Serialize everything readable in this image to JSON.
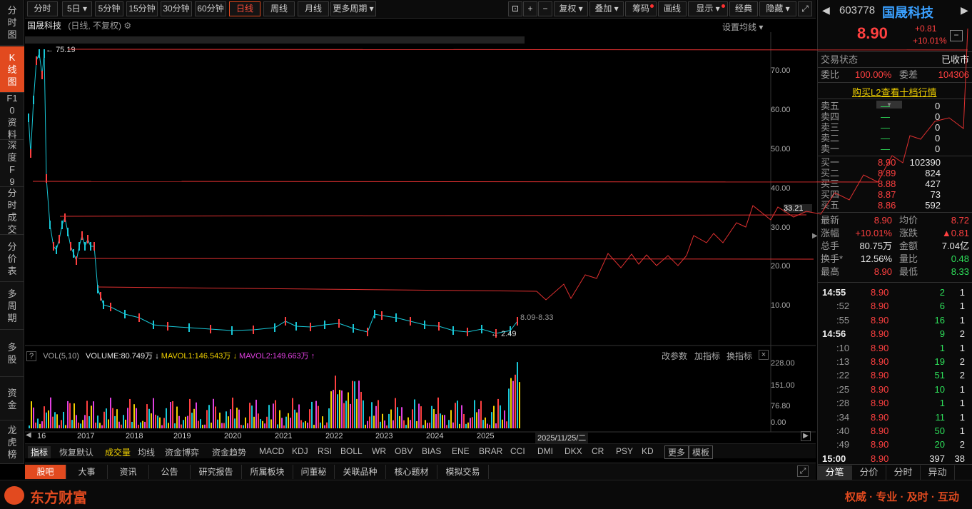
{
  "sidebar": {
    "items": [
      "分时图",
      "K线图",
      "F10资料",
      "深度F9",
      "分时成交",
      "分价表",
      "多周期",
      "多股",
      "资金",
      "龙虎榜"
    ]
  },
  "toolbar": {
    "periods": [
      "分时",
      "5日",
      "5分钟",
      "15分钟",
      "30分钟",
      "60分钟",
      "日线",
      "周线",
      "月线",
      "更多周期"
    ],
    "active_period": "日线",
    "right": [
      "复权",
      "叠加",
      "筹码",
      "画线",
      "显示",
      "经典",
      "隐藏"
    ]
  },
  "chart": {
    "stock_name": "国晟科技",
    "mode": "(日线, 不复权)",
    "settings": "设置均线",
    "price_levels": [
      "70.00",
      "60.00",
      "50.00",
      "40.00",
      "30.00",
      "20.00",
      "10.00"
    ],
    "current_marker": "33.21",
    "high_marker": "75.19",
    "low_marker": "2.49",
    "range_marker": "8.09-8.33",
    "vol_line": {
      "label": "VOL(5,10)",
      "volume": "VOLUME:80.749万",
      "mavol1": "MAVOL1:146.543万",
      "mavol2": "MAVOL2:149.663万"
    },
    "vol_buttons": [
      "改参数",
      "加指标",
      "换指标"
    ],
    "vol_levels": [
      "228.00",
      "151.00",
      "76.80",
      "0.00"
    ],
    "years": [
      "16",
      "2017",
      "2018",
      "2019",
      "2020",
      "2021",
      "2022",
      "2023",
      "2024",
      "2025"
    ],
    "cursor_date": "2025/11/25/二"
  },
  "indicators": [
    "指标",
    "恢复默认",
    "成交量",
    "均线",
    "资金博弈",
    "资金趋势",
    "MACD",
    "KDJ",
    "RSI",
    "BOLL",
    "WR",
    "OBV",
    "BIAS",
    "ENE",
    "BRAR",
    "CCI",
    "DMI",
    "DKX",
    "CR",
    "PSY",
    "KD",
    "更多",
    "模板"
  ],
  "bottom_tabs": [
    "股吧",
    "大事",
    "资讯",
    "公告",
    "研究报告",
    "所属板块",
    "问董秘",
    "关联品种",
    "核心题材",
    "模拟交易"
  ],
  "footer": {
    "brand": "东方财富",
    "slogan": "权威 · 专业 · 及时 · 互动"
  },
  "quote": {
    "code": "603778",
    "name": "国晟科技",
    "price": "8.90",
    "change": "+0.81",
    "pct": "+10.01%",
    "status_label": "交易状态",
    "status": "已收市",
    "weibi_label": "委比",
    "weibi": "100.00%",
    "weicha_label": "委差",
    "weicha": "104306",
    "l2": "购买L2查看十档行情",
    "asks": [
      {
        "label": "卖五",
        "price": "—",
        "vol": "0"
      },
      {
        "label": "卖四",
        "price": "—",
        "vol": "0"
      },
      {
        "label": "卖三",
        "price": "—",
        "vol": "0"
      },
      {
        "label": "卖二",
        "price": "—",
        "vol": "0"
      },
      {
        "label": "卖一",
        "price": "—",
        "vol": "0"
      }
    ],
    "bids": [
      {
        "label": "买一",
        "price": "8.90",
        "vol": "102390"
      },
      {
        "label": "买二",
        "price": "8.89",
        "vol": "824"
      },
      {
        "label": "买三",
        "price": "8.88",
        "vol": "427"
      },
      {
        "label": "买四",
        "price": "8.87",
        "vol": "73"
      },
      {
        "label": "买五",
        "price": "8.86",
        "vol": "592"
      }
    ],
    "stats": [
      {
        "l1": "最新",
        "v1": "8.90",
        "l2": "均价",
        "v2": "8.72"
      },
      {
        "l1": "涨幅",
        "v1": "+10.01%",
        "l2": "涨跌",
        "v2": "▲0.81"
      },
      {
        "l1": "总手",
        "v1": "80.75万",
        "l2": "金额",
        "v2": "7.04亿"
      },
      {
        "l1": "换手*",
        "v1": "12.56%",
        "l2": "量比",
        "v2": "0.48"
      },
      {
        "l1": "最高",
        "v1": "8.90",
        "l2": "最低",
        "v2": "8.33"
      }
    ],
    "ticks": [
      {
        "t": "14:55",
        "p": "8.90",
        "v": "2",
        "n": "1"
      },
      {
        "t": ":52",
        "p": "8.90",
        "v": "6",
        "n": "1"
      },
      {
        "t": ":55",
        "p": "8.90",
        "v": "16",
        "n": "1"
      },
      {
        "t": "14:56",
        "p": "8.90",
        "v": "9",
        "n": "2"
      },
      {
        "t": ":10",
        "p": "8.90",
        "v": "1",
        "n": "1"
      },
      {
        "t": ":13",
        "p": "8.90",
        "v": "19",
        "n": "2"
      },
      {
        "t": ":22",
        "p": "8.90",
        "v": "51",
        "n": "2"
      },
      {
        "t": ":25",
        "p": "8.90",
        "v": "10",
        "n": "1"
      },
      {
        "t": ":28",
        "p": "8.90",
        "v": "1",
        "n": "1"
      },
      {
        "t": ":34",
        "p": "8.90",
        "v": "11",
        "n": "1"
      },
      {
        "t": ":40",
        "p": "8.90",
        "v": "50",
        "n": "1"
      },
      {
        "t": ":49",
        "p": "8.90",
        "v": "20",
        "n": "2"
      },
      {
        "t": "15:00",
        "p": "8.90",
        "v": "397",
        "n": "38"
      }
    ],
    "rtabs": [
      "分笔",
      "分价",
      "分时",
      "异动"
    ]
  },
  "colors": {
    "accent": "#e24a1f",
    "up": "#ff4040",
    "down": "#2ee05a",
    "cyan": "#18c8d8"
  }
}
